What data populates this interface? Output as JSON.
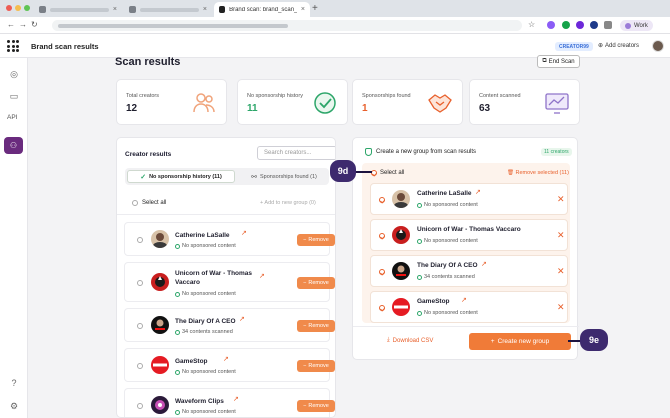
{
  "browser": {
    "active_tab_title": "Brand scan: brand_scan_te...",
    "profile_label": "Work"
  },
  "app": {
    "title": "Brand scan results",
    "creator_badge": "CREATOR99",
    "add_creators_label": "Add creators",
    "sidebar_api_label": "API"
  },
  "page": {
    "title": "Scan results",
    "end_scan_label": "End Scan"
  },
  "stats": [
    {
      "label": "Total creators",
      "value": "12",
      "color": "#1f1f2e",
      "icon": "people-icon"
    },
    {
      "label": "No sponsorship history",
      "value": "11",
      "color": "#2da66a",
      "icon": "check-circle-icon"
    },
    {
      "label": "Sponsorships found",
      "value": "1",
      "color": "#e8602c",
      "icon": "handshake-icon"
    },
    {
      "label": "Content scanned",
      "value": "63",
      "color": "#1f1f2e",
      "icon": "chart-screen-icon"
    }
  ],
  "creator_results": {
    "title": "Creator results",
    "search_placeholder": "Search creators...",
    "tab_no_sponsorship": "No sponsorship history (11)",
    "tab_sponsorships": "Sponsorships found (1)",
    "select_all": "Select all",
    "add_to_group": "+  Add to new group (0)",
    "remove_label": "Remove",
    "rows": [
      {
        "name": "Catherine LaSalle",
        "status": "No sponsored content"
      },
      {
        "name": "Unicorn of War - Thomas Vaccaro",
        "status": "No sponsored content"
      },
      {
        "name": "The Diary Of A CEO",
        "status": "34 contents scanned"
      },
      {
        "name": "GameStop",
        "status": "No sponsored content"
      },
      {
        "name": "Waveform Clips",
        "status": "No sponsored content"
      }
    ]
  },
  "group_panel": {
    "title": "Create a new group from scan results",
    "badge": "11 creators",
    "select_all": "Select all",
    "remove_selected": "Remove selected (11)",
    "rows": [
      {
        "name": "Catherine LaSalle",
        "status": "No sponsored content"
      },
      {
        "name": "Unicorn of War - Thomas Vaccaro",
        "status": "No sponsored content"
      },
      {
        "name": "The Diary Of A CEO",
        "status": "34 contents scanned"
      },
      {
        "name": "GameStop",
        "status": "No sponsored content"
      }
    ],
    "download_csv": "Download CSV",
    "create_group": "Create new group"
  },
  "callouts": {
    "a": "9d",
    "b": "9e"
  }
}
